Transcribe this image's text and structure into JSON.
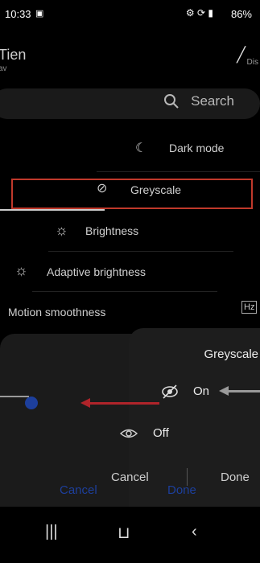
{
  "status": {
    "time": "10:33",
    "battery": "86%"
  },
  "header": {
    "title": "Tien",
    "subtitle": "av",
    "right_label": "Dis"
  },
  "search": {
    "label": "Search"
  },
  "rows": [
    {
      "label": "Dark mode",
      "icon": "moon-icon"
    },
    {
      "label": "Greyscale",
      "icon": "eye-slash-icon"
    },
    {
      "label": "Brightness",
      "icon": "sun-icon"
    },
    {
      "label": "Adaptive brightness",
      "icon": "sun-auto-icon"
    },
    {
      "label": "Motion smoothness",
      "icon": "hz-icon"
    }
  ],
  "dialog": {
    "title": "Greyscale",
    "options": [
      {
        "label": "On",
        "selected": true
      },
      {
        "label": "Off",
        "selected": false
      }
    ],
    "cancel_label": "Cancel",
    "done_label": "Done",
    "cancel_label_ghost": "Cancel",
    "done_label_ghost": "Done",
    "hz_label": "Hz"
  },
  "colors": {
    "accent": "#1d3f9c",
    "highlight": "#c0392b",
    "arrow": "#b0242a"
  }
}
